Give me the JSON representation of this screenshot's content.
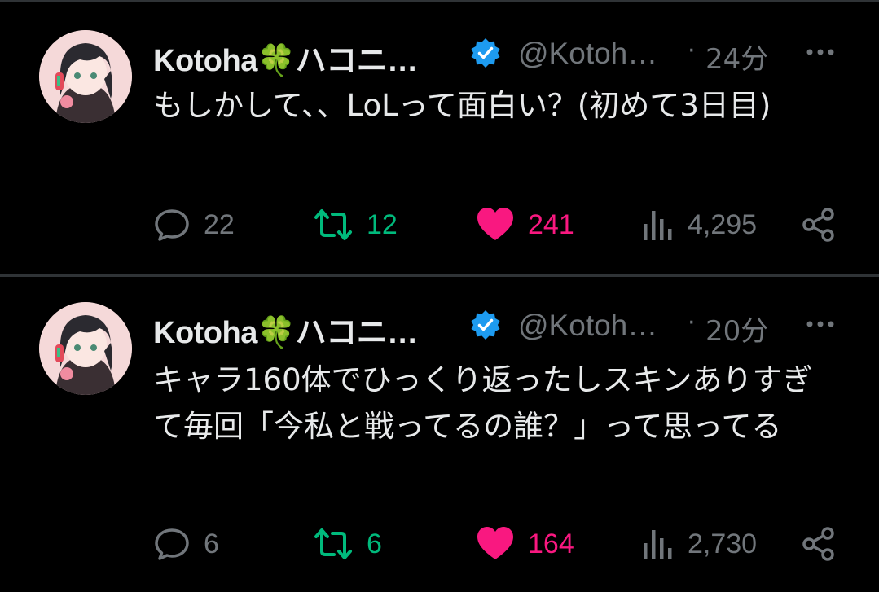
{
  "posts": [
    {
      "author_name": "Kotoha🍀ハコニ…",
      "handle": "@Kotoh…",
      "separator": "·",
      "time": "24分",
      "text": "もしかして、、LoLって面白い？(初めて3日目)",
      "replies": "22",
      "retweets": "12",
      "likes": "241",
      "views": "4,295"
    },
    {
      "author_name": "Kotoha🍀ハコニ…",
      "handle": "@Kotoh…",
      "separator": "·",
      "time": "20分",
      "text": "キャラ160体でひっくり返ったしスキンありすぎて毎回「今私と戦ってるの誰？」って思ってる",
      "replies": "6",
      "retweets": "6",
      "likes": "164",
      "views": "2,730"
    }
  ],
  "colors": {
    "background": "#000000",
    "text": "#e7e9ea",
    "muted": "#71767b",
    "retweet": "#00ba7c",
    "like": "#f91880",
    "verified": "#1d9bf0",
    "divider": "#2f3336"
  },
  "icons": {
    "verified": "verified-badge-icon",
    "more": "more-dots-icon",
    "reply": "reply-bubble-icon",
    "retweet": "retweet-icon",
    "like": "heart-filled-icon",
    "views": "views-bar-icon",
    "share": "share-icon"
  }
}
